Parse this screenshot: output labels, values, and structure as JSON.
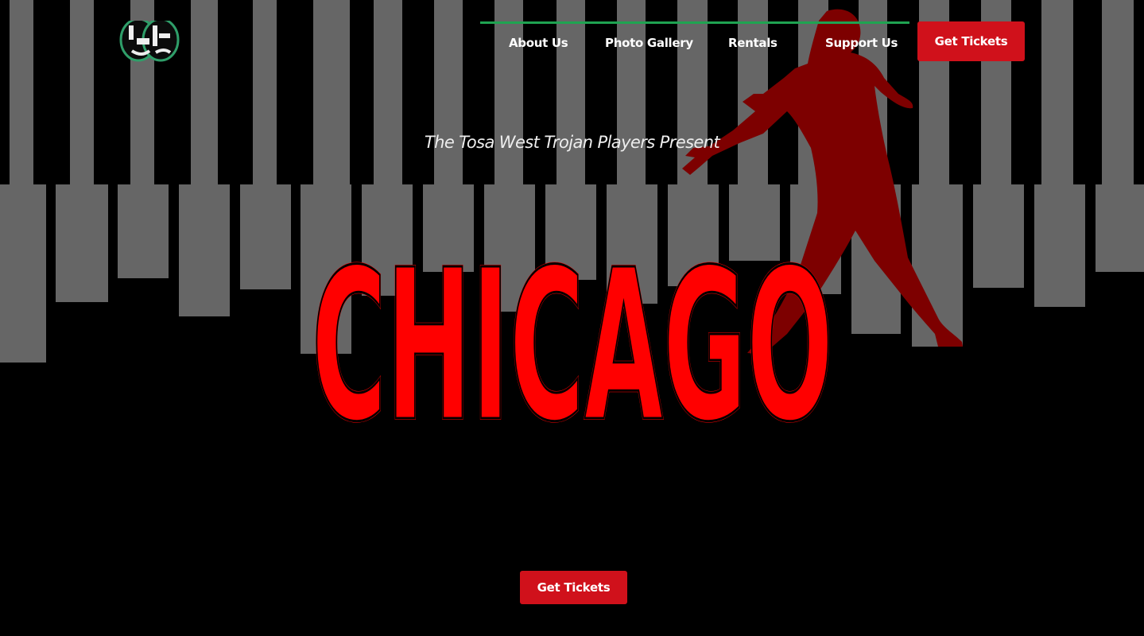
{
  "header": {
    "nav": [
      {
        "label": "About Us"
      },
      {
        "label": "Photo Gallery"
      },
      {
        "label": "Rentals"
      },
      {
        "label": "Support Us"
      }
    ],
    "cta_label": "Get Tickets",
    "logo_icon": "theater-masks-logo-icon"
  },
  "hero": {
    "tagline": "The Tosa West Trojan Players Present",
    "title": "CHICAGO",
    "cta_label": "Get Tickets",
    "background_motif": "piano-keys",
    "figure": "dancer-silhouette"
  },
  "colors": {
    "background": "#000000",
    "piano_key": "#666666",
    "accent_red": "#ff0000",
    "button_red": "#d0111b",
    "dancer_red": "#7d0000",
    "nav_rule_green": "#1fa351"
  }
}
